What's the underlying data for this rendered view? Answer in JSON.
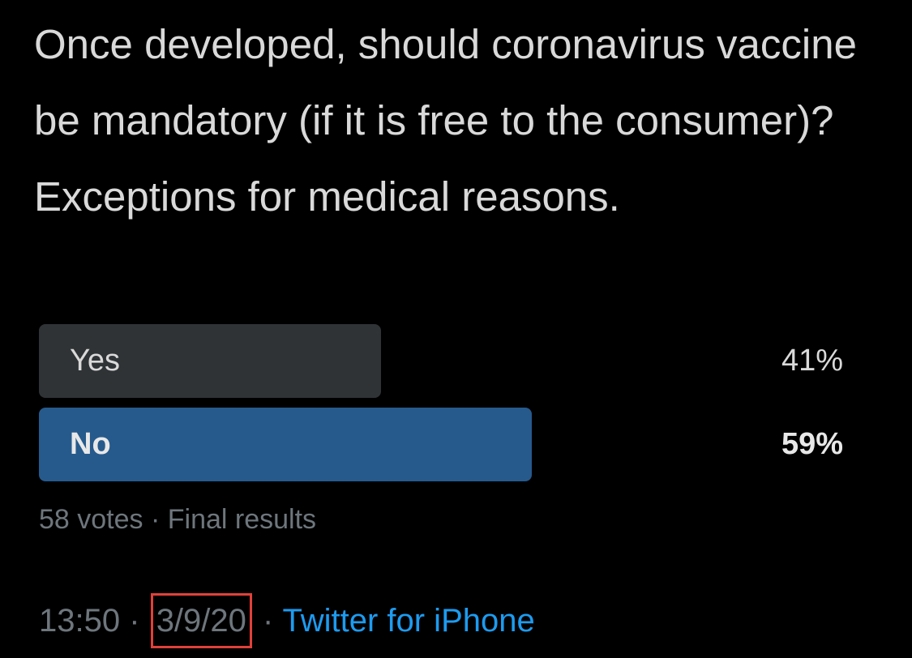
{
  "tweet": {
    "text": "Once developed, should coronavirus vaccine be mandatory (if it is free to the consumer)? Exceptions for medical reasons."
  },
  "poll": {
    "options": [
      {
        "label": "Yes",
        "percent_text": "41%",
        "percent": 41,
        "winner": false
      },
      {
        "label": "No",
        "percent_text": "59%",
        "percent": 59,
        "winner": true
      }
    ],
    "votes": "58 votes",
    "separator": "·",
    "status": "Final results"
  },
  "footer": {
    "time": "13:50",
    "sep1": "·",
    "date": "3/9/20",
    "sep2": "·",
    "source": "Twitter for iPhone"
  },
  "colors": {
    "loser_bar": "#2f3336",
    "winner_bar": "#265a8c",
    "link": "#1d9bf0",
    "highlight_box": "#e0413a"
  }
}
